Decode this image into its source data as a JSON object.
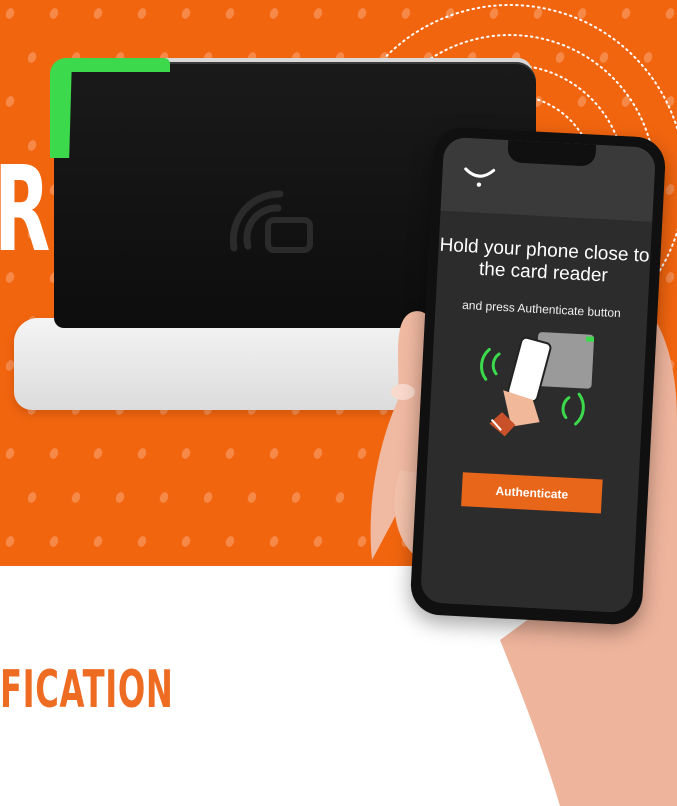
{
  "banner": {
    "background_color": "#f2650f",
    "partial_heading_letter": "R"
  },
  "footer": {
    "partial_text": "FICATION",
    "text_color": "#ee6b22"
  },
  "card_reader": {
    "icon": "nfc-reader-icon",
    "accent_color": "#3bd94b"
  },
  "phone": {
    "back_icon": "chevron-down-icon",
    "title": "Hold your phone close to the card reader",
    "subtitle": "and press Authenticate button",
    "illustration_icon": "hand-phone-nfc-icon",
    "authenticate_button": "Authenticate",
    "button_color": "#e7661a"
  }
}
